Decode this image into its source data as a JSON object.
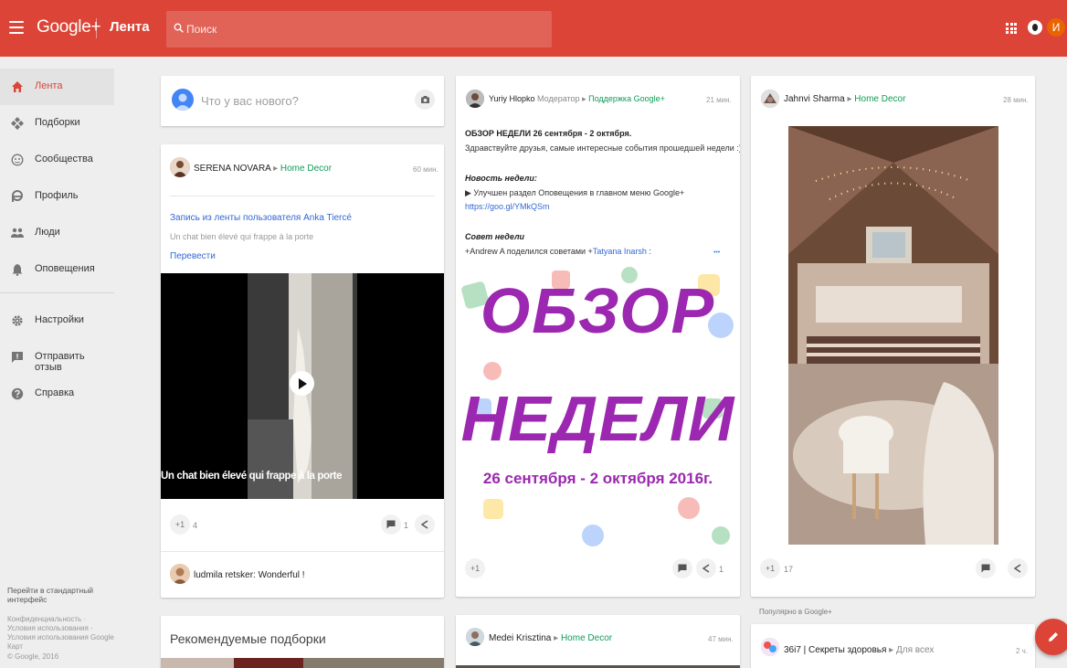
{
  "header": {
    "logo": "Google+",
    "page_title": "Лента",
    "search_placeholder": "Поиск",
    "avatar_letter": "И",
    "color": "#db4437"
  },
  "sidebar": {
    "items": [
      {
        "label": "Лента",
        "icon": "home-icon"
      },
      {
        "label": "Подборки",
        "icon": "collections-icon"
      },
      {
        "label": "Сообщества",
        "icon": "communities-icon"
      },
      {
        "label": "Профиль",
        "icon": "profile-icon"
      },
      {
        "label": "Люди",
        "icon": "people-icon"
      },
      {
        "label": "Оповещения",
        "icon": "bell-icon"
      },
      {
        "label": "Настройки",
        "icon": "gear-icon"
      },
      {
        "label": "Отправить отзыв",
        "icon": "feedback-icon"
      },
      {
        "label": "Справка",
        "icon": "help-icon"
      }
    ],
    "classic_link": "Перейти в стандартный интерфейс",
    "footer_links": "Конфиденциальность · Условия использования · Условия использования Google Карт",
    "copyright": "© Google, 2016"
  },
  "compose": {
    "placeholder": "Что у вас нового?"
  },
  "post_serena": {
    "author": "SERENA NOVARA",
    "community": "Home Decor",
    "time": "60 мин.",
    "reshare_prefix": "Запись из ленты пользователя",
    "reshare_user": "Anka Tiercé",
    "text": "Un chat bien élevé qui frappe à la porte",
    "translate": "Перевести",
    "video_caption": "Un chat bien élevé qui frappe à la porte",
    "plus_count": "4",
    "comment_count": "1",
    "comment_author": "ludmila retsker",
    "comment_text": "Wonderful !"
  },
  "recommended": {
    "title": "Рекомендуемые подборки"
  },
  "post_yuriy": {
    "author": "Yuriy Hlopko",
    "role": "Модератор",
    "community": "Поддержка Google+",
    "time": "21 мин.",
    "headline": "ОБЗОР НЕДЕЛИ 26 сентября - 2 октября.",
    "intro": "Здравствуйте друзья, самые интересные события прошедшей недели :)",
    "news_label": "Новость недели:",
    "news_text": "▶ Улучшен раздел Оповещения в главном меню Google+",
    "news_link": "https://goo.gl/YMkQSm",
    "tip_label": "Совет недели",
    "tip_text_prefix": "+Andrew A поделился советами +",
    "tip_link": "Tatyana Inarsh",
    "tip_text_suffix": " :",
    "more": "• • •",
    "banner_line1": "ОБЗОР",
    "banner_line2": "НЕДЕЛИ",
    "banner_dates": "26 сентября - 2 октября 2016г.",
    "share_count": "1"
  },
  "post_medei": {
    "author": "Medei Krisztina",
    "community": "Home Decor",
    "time": "47 мин."
  },
  "post_jahnvi": {
    "author": "Jahnvi Sharma",
    "community": "Home Decor",
    "time": "28 мин.",
    "plus_count": "17"
  },
  "popular": {
    "label": "Популярно в Google+",
    "author": "36i7 | Секреты здоровья",
    "community": "Для всех",
    "time": "2 ч."
  }
}
